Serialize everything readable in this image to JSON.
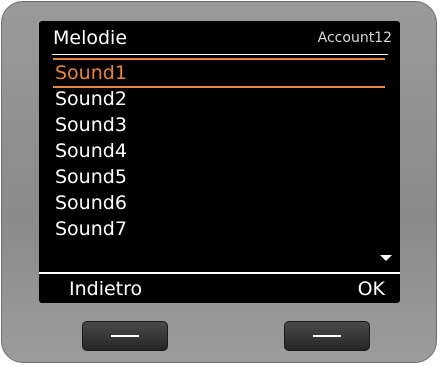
{
  "header": {
    "title": "Melodie",
    "account": "Account12"
  },
  "list": {
    "selected_index": 0,
    "items": [
      {
        "label": "Sound1"
      },
      {
        "label": "Sound2"
      },
      {
        "label": "Sound3"
      },
      {
        "label": "Sound4"
      },
      {
        "label": "Sound5"
      },
      {
        "label": "Sound6"
      },
      {
        "label": "Sound7"
      }
    ]
  },
  "softkeys": {
    "left_label": "Indietro",
    "right_label": "OK"
  },
  "icons": {
    "scroll_down": "chevron-down-icon"
  },
  "colors": {
    "selection": "#e8863a",
    "screen_background": "#000000",
    "text": "#ffffff"
  }
}
